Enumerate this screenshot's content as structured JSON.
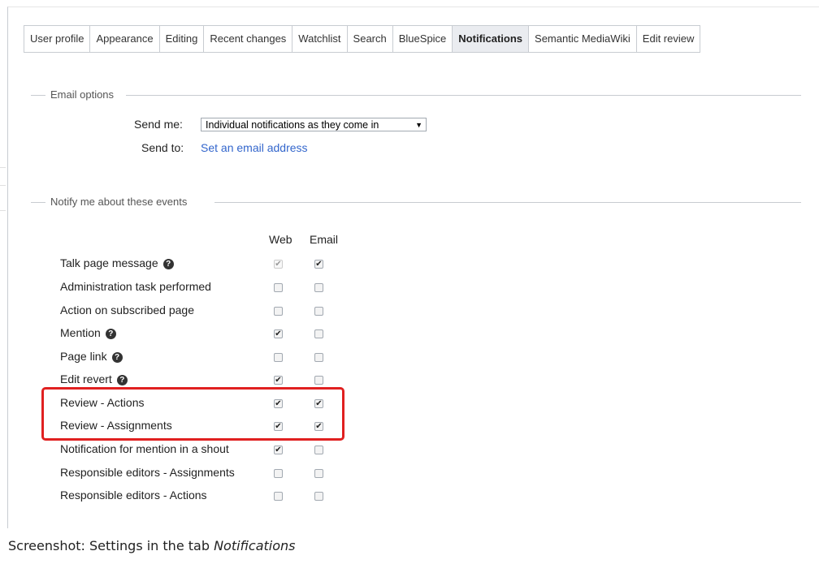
{
  "tabs": [
    {
      "label": "User profile",
      "active": false
    },
    {
      "label": "Appearance",
      "active": false
    },
    {
      "label": "Editing",
      "active": false
    },
    {
      "label": "Recent changes",
      "active": false
    },
    {
      "label": "Watchlist",
      "active": false
    },
    {
      "label": "Search",
      "active": false
    },
    {
      "label": "BlueSpice",
      "active": false
    },
    {
      "label": "Notifications",
      "active": true
    },
    {
      "label": "Semantic MediaWiki",
      "active": false
    },
    {
      "label": "Edit review",
      "active": false
    }
  ],
  "email_options": {
    "legend": "Email options",
    "send_me_label": "Send me:",
    "send_me_value": "Individual notifications as they come in",
    "send_to_label": "Send to:",
    "send_to_link": "Set an email address"
  },
  "notify": {
    "legend": "Notify me about these events",
    "col_web": "Web",
    "col_email": "Email",
    "events": [
      {
        "label": "Talk page message",
        "help": true,
        "web": true,
        "email": true,
        "web_disabled": true
      },
      {
        "label": "Administration task performed",
        "help": false,
        "web": false,
        "email": false
      },
      {
        "label": "Action on subscribed page",
        "help": false,
        "web": false,
        "email": false
      },
      {
        "label": "Mention",
        "help": true,
        "web": true,
        "email": false
      },
      {
        "label": "Page link",
        "help": true,
        "web": false,
        "email": false
      },
      {
        "label": "Edit revert",
        "help": true,
        "web": true,
        "email": false
      },
      {
        "label": "Review - Actions",
        "help": false,
        "web": true,
        "email": true
      },
      {
        "label": "Review - Assignments",
        "help": false,
        "web": true,
        "email": true
      },
      {
        "label": "Notification for mention in a shout",
        "help": false,
        "web": true,
        "email": false
      },
      {
        "label": "Responsible editors - Assignments",
        "help": false,
        "web": false,
        "email": false
      },
      {
        "label": "Responsible editors - Actions",
        "help": false,
        "web": false,
        "email": false
      }
    ]
  },
  "caption": {
    "prefix": "Screenshot: Settings in the tab ",
    "tab_name": "Notifications"
  },
  "colors": {
    "active_tab_bg": "#eaecf0",
    "link": "#3366cc",
    "highlight": "#e02020"
  }
}
